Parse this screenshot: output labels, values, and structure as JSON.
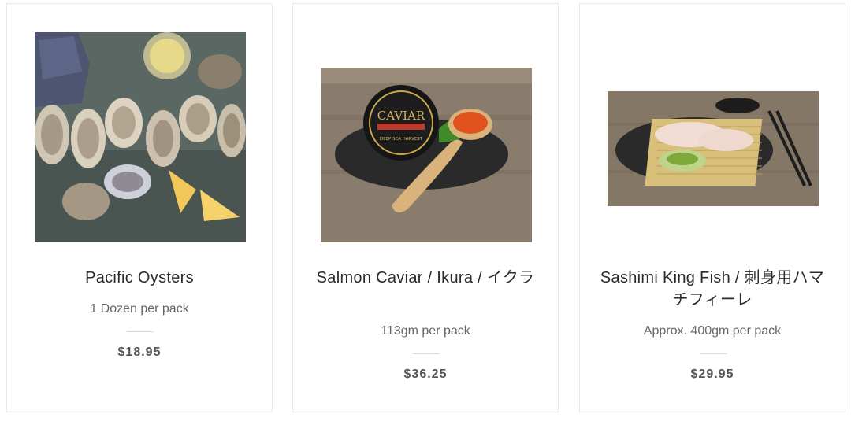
{
  "products": [
    {
      "image": "pacific-oysters-photo",
      "title": "Pacific Oysters",
      "subtitle": "1 Dozen per pack",
      "price": "$18.95"
    },
    {
      "image": "salmon-caviar-photo",
      "title": "Salmon Caviar / Ikura / イクラ",
      "subtitle": "113gm per pack",
      "price": "$36.25",
      "jar_label": "CAVIAR",
      "jar_sublabel": "DEEP SEA HARVEST"
    },
    {
      "image": "sashimi-king-fish-photo",
      "title": "Sashimi King Fish / 刺身用ハマチフィーレ",
      "subtitle": "Approx. 400gm per pack",
      "price": "$29.95"
    }
  ],
  "colors": {
    "border": "#e8e8e8",
    "title": "#2b2b2b",
    "subtitle": "#666666",
    "price": "#555555"
  }
}
